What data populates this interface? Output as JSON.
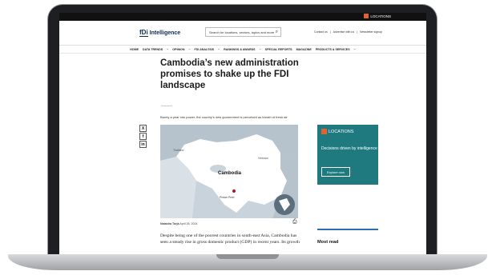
{
  "topbar": {
    "locations_label": "LOCATIONS"
  },
  "header": {
    "logo_mark": "fDi",
    "logo_text": "Intelligence",
    "search_placeholder": "Search for locations, sectors, topics and more",
    "links": [
      "Contact us",
      "|",
      "Advertise with us",
      "|",
      "Newsletter signup"
    ]
  },
  "nav": {
    "items": [
      "HOME",
      "DATA TRENDS",
      "~",
      "OPINION",
      "~",
      "FDI ANALYSIS",
      "~",
      "RANKINGS & AWARDS",
      "~",
      "SPECIAL REPORTS",
      "MAGAZINE",
      "PRODUCTS & SERVICES",
      "~"
    ]
  },
  "article": {
    "title": "Cambodia’s new administration promises to shake up the FDI landscape",
    "standfirst": "Barely a year into power, the country’s new government is perceived as breath of fresh air",
    "byline_author": "Natasha Turja",
    "byline_date": "April 26, 2024",
    "body": "Despite being one of the poorest countries in south-east Asia, Cambodia has seen a steady rise in gross domestic product (GDP) in recent years. Its growth"
  },
  "map": {
    "country_label": "Cambodia",
    "neighbor_left": "Thailand",
    "neighbor_right": "Vietnam",
    "capital_label": "Phnom Penh"
  },
  "social": {
    "x": "X",
    "facebook": "f",
    "linkedin": "in"
  },
  "sidebar": {
    "promo_logo": "LOCATIONS",
    "promo_text": "Decisions driven by intelligence",
    "promo_button": "Explore now",
    "most_read": "Most read"
  }
}
